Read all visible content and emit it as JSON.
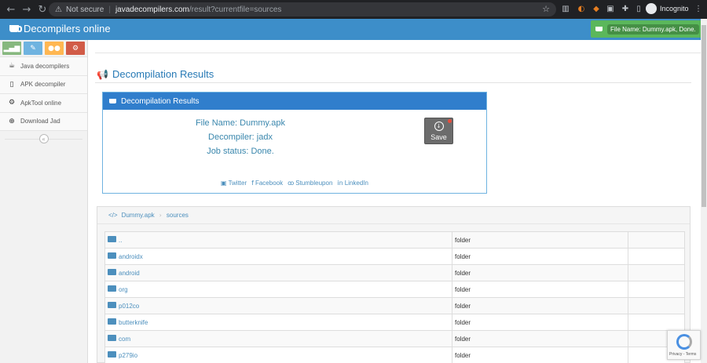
{
  "browser": {
    "security": "Not secure",
    "host": "javadecompilers.com",
    "path": "/result?currentfile=sources",
    "incognito_label": "Incognito"
  },
  "header": {
    "brand": "Decompilers online",
    "status_pill": "File Name: Dummy.apk, Done."
  },
  "sidebar": {
    "items": [
      {
        "label": "Java decompilers",
        "icon": "coffee-icon"
      },
      {
        "label": "APK decompiler",
        "icon": "mobile-icon"
      },
      {
        "label": "ApkTool online",
        "icon": "gear-icon"
      },
      {
        "label": "Download Jad",
        "icon": "download-icon"
      }
    ]
  },
  "page": {
    "title": "Decompilation Results"
  },
  "result": {
    "header": "Decompilation Results",
    "file_name": "File Name: Dummy.apk",
    "decompiler": "Decompiler: jadx",
    "job_status": "Job status: Done.",
    "save_label": "Save",
    "social": [
      "Twitter",
      "Facebook",
      "Stumbleupon",
      "LinkedIn"
    ]
  },
  "filebrowser": {
    "breadcrumb": [
      "Dummy.apk",
      "sources"
    ],
    "rows": [
      {
        "name": "..",
        "type": "folder"
      },
      {
        "name": "androidx",
        "type": "folder"
      },
      {
        "name": "android",
        "type": "folder"
      },
      {
        "name": "org",
        "type": "folder"
      },
      {
        "name": "p012co",
        "type": "folder"
      },
      {
        "name": "butterknife",
        "type": "folder"
      },
      {
        "name": "com",
        "type": "folder"
      },
      {
        "name": "p279io",
        "type": "folder"
      }
    ]
  },
  "recaptcha": {
    "footer": "Privacy - Terms"
  },
  "colors": {
    "header_blue": "#3d8ec9",
    "widget_blue": "#307ecc",
    "link_blue": "#4c8fbd",
    "status_green": "#5bb75b"
  }
}
